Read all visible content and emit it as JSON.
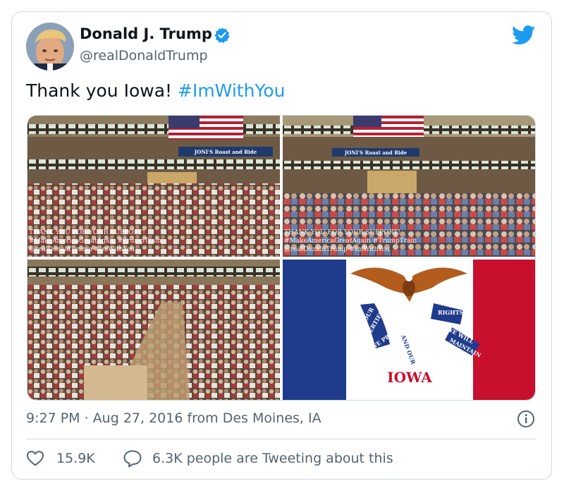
{
  "author": {
    "display_name": "Donald J. Trump",
    "handle": "@realDonaldTrump",
    "verified": true
  },
  "tweet": {
    "text": "Thank you Iowa!",
    "hashtag": "#ImWithYou"
  },
  "media": {
    "photos": [
      {
        "description": "rally crowd in arena",
        "banner": "JONI'S Roast and Ride",
        "overlay_lines": [
          "THANK YOU FOR YOUR SUPPORT!",
          "#MakeAmericaGreatAgain #TrumpTrain",
          "@realDonaldTrump #ImWithYou"
        ]
      },
      {
        "description": "rally crowd in arena",
        "banner": "JONI'S Roast and Ride",
        "overlay_lines": [
          "THANK YOU FOR YOUR SUPPORT!",
          "#MakeAmericaGreatAgain #TrumpTrain",
          "@realDonaldTrump #ImWithYou"
        ]
      },
      {
        "description": "crowd seated in arena"
      },
      {
        "description": "Iowa state flag",
        "ribbon_words": [
          "OUR",
          "LIBERTIES",
          "WE PRIZE",
          "AND OUR",
          "RIGHTS",
          "WE WILL",
          "MAINTAIN"
        ],
        "state_name": "IOWA"
      }
    ]
  },
  "meta": {
    "timestamp": "9:27 PM · Aug 27, 2016 from Des Moines, IA"
  },
  "actions": {
    "like_count": "15.9K",
    "conversation": "6.3K people are Tweeting about this"
  },
  "colors": {
    "twitter_blue": "#1d9bf0",
    "like_color": "#536471",
    "iowa_blue": "#1f3b8c",
    "iowa_red": "#c8102e"
  }
}
